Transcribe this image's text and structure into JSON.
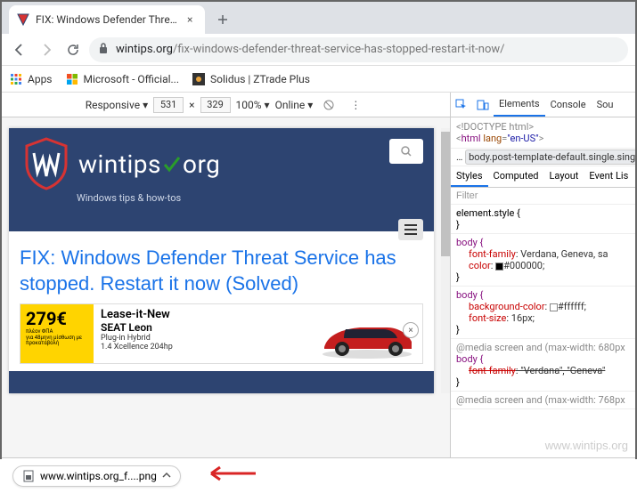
{
  "tab": {
    "title": "FIX: Windows Defender Threat Se",
    "close": "×"
  },
  "nav": {
    "back": "←",
    "forward": "→",
    "reload": "↻"
  },
  "omnibox": {
    "host": "wintips.org",
    "path": "/fix-windows-defender-threat-service-has-stopped-restart-it-now/"
  },
  "bookmarks": {
    "apps": "Apps",
    "ms": "Microsoft - Official...",
    "solidus": "Solidus | ZTrade Plus"
  },
  "devtools": {
    "device": "Responsive",
    "width": "531",
    "height": "329",
    "zoom": "100%",
    "throttle": "Online",
    "tabs": {
      "elements": "Elements",
      "console": "Console",
      "sources": "Sou"
    },
    "dom_doctype": "<!DOCTYPE html>",
    "dom_html": "html",
    "dom_lang_attr": "lang",
    "dom_lang_val": "\"en-US\"",
    "crumb": "body.post-template-default.single.sing",
    "styles_tabs": {
      "styles": "Styles",
      "computed": "Computed",
      "layout": "Layout",
      "events": "Event Lis"
    },
    "filter": "Filter",
    "css1_sel": "element.style {",
    "css1_close": "}",
    "css2_sel": "body {",
    "css2_p1": "font-family",
    "css2_v1": ": Verdana, Geneva, sa",
    "css2_p2": "color",
    "css2_v2": "#000000;",
    "css2_close": "}",
    "css3_sel": "body {",
    "css3_p1": "background-color",
    "css3_v1": "#ffffff;",
    "css3_p2": "font-size",
    "css3_v2": ": 16px;",
    "css3_close": "}",
    "css4_media": "@media screen and (max-width: 680px",
    "css4_sel": "body {",
    "css4_p1": "font-family",
    "css4_v1": ": \"Verdana\", \"Geneva\"",
    "css4_close": "}",
    "css5_media": "@media screen and (max-width: 768px"
  },
  "site": {
    "logo": "wintips",
    "logo2": "org",
    "tagline": "Windows tips & how-tos",
    "article_title": "FIX: Windows Defender Threat Service has stopped. Restart it now (Solved)"
  },
  "ad": {
    "price": "279€",
    "vat": "πλέον ΦΠΑ",
    "lease_line": "για 48μηνη μίσθωση με προκαταβολή",
    "headline": "Lease-it-New",
    "model": "SEAT Leon",
    "sub1": "Plug-in Hybrid",
    "sub2": "1.4 Xcellence 204hp",
    "close": "×"
  },
  "download": {
    "filename": "www.wintips.org_f....png"
  },
  "watermark": "www.wintips.org"
}
